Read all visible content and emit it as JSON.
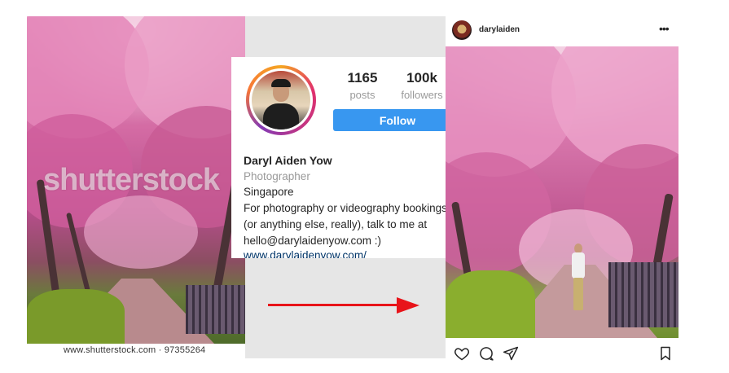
{
  "stock_image": {
    "watermark": "shutterstock",
    "caption": "www.shutterstock.com · 97355264"
  },
  "profile": {
    "posts_count": "1165",
    "posts_label": "posts",
    "followers_count": "100k",
    "followers_label": "followers",
    "follow_label": "Follow",
    "name": "Daryl Aiden Yow",
    "category": "Photographer",
    "bio_lines": [
      "Singapore",
      "For photography or videography bookings",
      "(or anything else, really), talk to me at",
      "hello@darylaidenyow.com :)"
    ],
    "website": "www.darylaidenyow.com/"
  },
  "post": {
    "username": "darylaiden",
    "more_label": "•••"
  },
  "colors": {
    "follow_button": "#3897f0",
    "arrow": "#e8141a",
    "panel_gray": "#e6e6e6",
    "link": "#003569"
  },
  "icons": [
    "heart-icon",
    "comment-icon",
    "share-icon",
    "bookmark-icon",
    "more-icon"
  ]
}
